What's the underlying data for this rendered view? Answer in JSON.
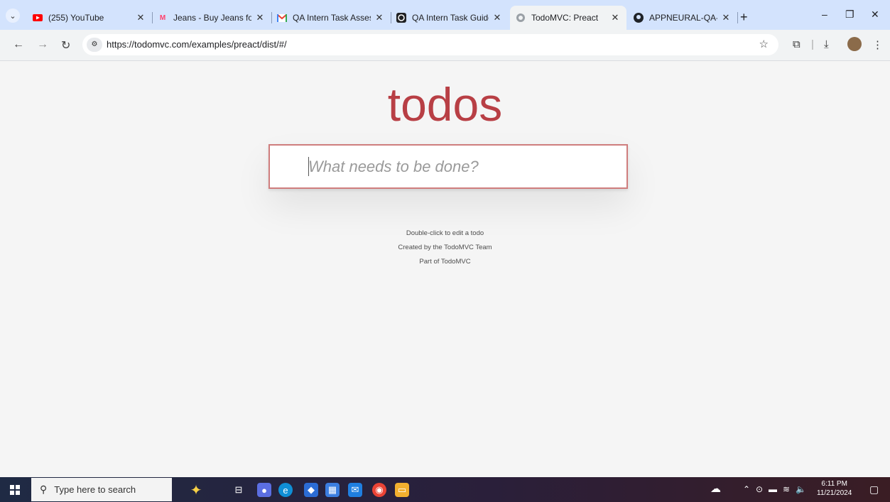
{
  "browser": {
    "tabs": [
      {
        "title": "(255) YouTube",
        "icon": "youtube-icon",
        "active": false
      },
      {
        "title": "Jeans - Buy Jeans for",
        "icon": "myntra-icon",
        "active": false
      },
      {
        "title": "QA Intern Task Assess",
        "icon": "gmail-icon",
        "active": false
      },
      {
        "title": "QA Intern Task Guide",
        "icon": "chatgpt-icon",
        "active": false
      },
      {
        "title": "TodoMVC: Preact",
        "icon": "globe-icon",
        "active": true
      },
      {
        "title": "APPNEURAL-QA-Inte",
        "icon": "github-icon",
        "active": false
      }
    ],
    "url": "https://todomvc.com/examples/preact/dist/#/"
  },
  "page": {
    "heading": "todos",
    "input_placeholder": "What needs to be done?",
    "info": {
      "line1": "Double-click to edit a todo",
      "line2": "Created by the TodoMVC Team",
      "line3": "Part of TodoMVC"
    }
  },
  "taskbar": {
    "search_placeholder": "Type here to search",
    "time": "6:11 PM",
    "date": "11/21/2024"
  },
  "colors": {
    "accent": "#b83f45",
    "tabstrip": "#d3e3fd",
    "page_background": "#f5f5f5"
  }
}
